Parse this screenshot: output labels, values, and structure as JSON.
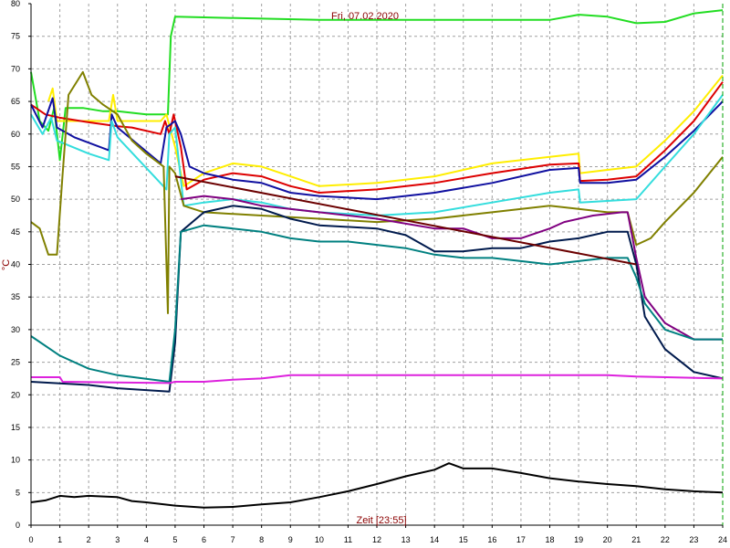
{
  "chart_data": {
    "type": "line",
    "title": "Fri, 07.02.2020",
    "xlabel": "Zeit [23:55]",
    "ylabel": "°C",
    "xlim": [
      0,
      24
    ],
    "ylim": [
      0,
      80
    ],
    "xticks": [
      0,
      1,
      2,
      3,
      4,
      5,
      6,
      7,
      8,
      9,
      10,
      11,
      12,
      13,
      14,
      15,
      16,
      17,
      18,
      19,
      20,
      21,
      22,
      23,
      24
    ],
    "yticks": [
      0,
      5,
      10,
      15,
      20,
      25,
      30,
      35,
      40,
      45,
      50,
      55,
      60,
      65,
      70,
      75,
      80
    ],
    "grid": true,
    "legend": "none",
    "series": [
      {
        "color": "#22dd22",
        "points": [
          [
            0,
            69.5
          ],
          [
            0.3,
            62
          ],
          [
            0.6,
            60.5
          ],
          [
            0.8,
            64
          ],
          [
            1,
            56
          ],
          [
            1.2,
            64
          ],
          [
            1.8,
            64
          ],
          [
            2.5,
            63.5
          ],
          [
            3,
            63.5
          ],
          [
            4,
            63
          ],
          [
            4.75,
            63
          ],
          [
            4.85,
            75
          ],
          [
            5,
            78
          ],
          [
            10,
            77.5
          ],
          [
            14,
            77.5
          ],
          [
            18,
            77.5
          ],
          [
            19,
            78.3
          ],
          [
            20,
            78
          ],
          [
            21,
            77
          ],
          [
            22,
            77.2
          ],
          [
            23,
            78.5
          ],
          [
            24,
            79
          ]
        ]
      },
      {
        "color": "#ffee00",
        "points": [
          [
            0.6,
            65
          ],
          [
            0.75,
            67
          ],
          [
            0.9,
            62
          ],
          [
            2.7,
            62
          ],
          [
            2.85,
            66
          ],
          [
            3,
            62
          ],
          [
            4.5,
            62
          ],
          [
            4.7,
            63
          ],
          [
            5,
            58
          ],
          [
            5.3,
            52
          ],
          [
            6,
            54
          ],
          [
            7,
            55.5
          ],
          [
            8,
            55
          ],
          [
            9,
            53.5
          ],
          [
            10,
            52
          ],
          [
            12,
            52.5
          ],
          [
            14,
            53.5
          ],
          [
            16,
            55.5
          ],
          [
            18,
            56.5
          ],
          [
            19,
            57
          ],
          [
            19.05,
            54
          ],
          [
            20,
            54.5
          ],
          [
            21,
            55
          ],
          [
            22,
            59
          ],
          [
            23,
            63.5
          ],
          [
            24,
            69
          ]
        ]
      },
      {
        "color": "#dd0000",
        "points": [
          [
            0,
            64.5
          ],
          [
            0.5,
            63
          ],
          [
            1,
            62.5
          ],
          [
            2,
            61.8
          ],
          [
            3,
            61.2
          ],
          [
            3.5,
            61
          ],
          [
            4.5,
            60
          ],
          [
            4.65,
            62
          ],
          [
            4.8,
            60
          ],
          [
            4.95,
            63
          ],
          [
            5.2,
            58
          ],
          [
            5.4,
            51.5
          ],
          [
            6,
            53
          ],
          [
            7,
            54
          ],
          [
            8,
            53.5
          ],
          [
            9,
            52
          ],
          [
            10,
            51
          ],
          [
            12,
            51.5
          ],
          [
            14,
            52.5
          ],
          [
            16,
            54
          ],
          [
            18,
            55.3
          ],
          [
            19,
            55.5
          ],
          [
            19.05,
            52.8
          ],
          [
            20,
            53
          ],
          [
            21,
            53.5
          ],
          [
            22,
            57.5
          ],
          [
            23,
            62
          ],
          [
            24,
            68
          ]
        ]
      },
      {
        "color": "#1010a0",
        "points": [
          [
            0,
            64.5
          ],
          [
            0.4,
            61
          ],
          [
            0.75,
            65.5
          ],
          [
            0.9,
            61
          ],
          [
            1.5,
            59.5
          ],
          [
            2.7,
            57.5
          ],
          [
            2.8,
            63
          ],
          [
            3,
            61
          ],
          [
            4.5,
            55.5
          ],
          [
            4.7,
            61
          ],
          [
            5,
            62
          ],
          [
            5.2,
            60
          ],
          [
            5.5,
            55
          ],
          [
            6,
            54
          ],
          [
            7,
            53
          ],
          [
            8,
            52.5
          ],
          [
            9,
            51
          ],
          [
            10,
            50.5
          ],
          [
            12,
            50
          ],
          [
            14,
            51
          ],
          [
            16,
            52.5
          ],
          [
            18,
            54.5
          ],
          [
            19,
            54.8
          ],
          [
            19.05,
            52.5
          ],
          [
            20,
            52.5
          ],
          [
            21,
            53
          ],
          [
            22,
            56.5
          ],
          [
            23,
            60.5
          ],
          [
            24,
            65
          ]
        ]
      },
      {
        "color": "#33dddd",
        "points": [
          [
            0,
            63
          ],
          [
            0.4,
            60
          ],
          [
            0.7,
            62.5
          ],
          [
            0.9,
            59
          ],
          [
            2,
            57
          ],
          [
            2.7,
            56
          ],
          [
            2.8,
            62
          ],
          [
            3,
            59.5
          ],
          [
            4.7,
            51.5
          ],
          [
            4.8,
            60
          ],
          [
            5,
            61
          ],
          [
            5.3,
            49
          ],
          [
            6,
            49.5
          ],
          [
            7,
            50
          ],
          [
            8,
            49.5
          ],
          [
            9,
            48.5
          ],
          [
            10,
            48
          ],
          [
            12,
            47.5
          ],
          [
            14,
            48
          ],
          [
            16,
            49.5
          ],
          [
            18,
            51
          ],
          [
            19,
            51.5
          ],
          [
            19.05,
            49.5
          ],
          [
            21,
            50
          ],
          [
            22,
            55
          ],
          [
            23,
            60
          ],
          [
            24,
            66
          ]
        ]
      },
      {
        "color": "#808000",
        "points": [
          [
            0,
            46.5
          ],
          [
            0.3,
            45.5
          ],
          [
            0.6,
            41.5
          ],
          [
            0.9,
            41.5
          ],
          [
            1.1,
            54
          ],
          [
            1.3,
            66
          ],
          [
            1.8,
            69.5
          ],
          [
            2.1,
            66
          ],
          [
            2.5,
            64.5
          ],
          [
            3,
            63
          ],
          [
            3.5,
            59
          ],
          [
            4,
            57
          ],
          [
            4.6,
            55
          ],
          [
            4.75,
            32.5
          ],
          [
            4.8,
            55
          ],
          [
            5,
            54
          ],
          [
            5.3,
            49
          ],
          [
            6,
            48
          ],
          [
            8,
            47.5
          ],
          [
            10,
            47
          ],
          [
            12,
            46.5
          ],
          [
            14,
            47
          ],
          [
            16,
            48
          ],
          [
            18,
            49
          ],
          [
            19,
            48.5
          ],
          [
            20,
            48
          ],
          [
            20.7,
            48
          ],
          [
            21,
            43
          ],
          [
            21.5,
            44
          ],
          [
            22,
            46.5
          ],
          [
            23,
            51
          ],
          [
            24,
            56.5
          ]
        ]
      },
      {
        "color": "#800080",
        "points": [
          [
            5.2,
            50
          ],
          [
            6,
            50.5
          ],
          [
            7,
            50
          ],
          [
            8,
            49
          ],
          [
            10,
            48
          ],
          [
            12,
            47
          ],
          [
            14,
            45.5
          ],
          [
            15,
            45.5
          ],
          [
            16,
            44
          ],
          [
            17,
            44
          ],
          [
            18,
            45.5
          ],
          [
            18.5,
            46.5
          ],
          [
            19.5,
            47.5
          ],
          [
            20.5,
            48
          ],
          [
            20.7,
            48
          ],
          [
            21,
            41
          ],
          [
            21.3,
            35
          ],
          [
            22,
            31
          ],
          [
            23,
            28.5
          ],
          [
            24,
            28.5
          ]
        ]
      },
      {
        "color": "#001a4d",
        "points": [
          [
            0,
            22
          ],
          [
            2,
            21.5
          ],
          [
            3,
            21
          ],
          [
            4.8,
            20.5
          ],
          [
            5,
            28
          ],
          [
            5.2,
            45
          ],
          [
            6,
            48
          ],
          [
            7,
            49
          ],
          [
            8,
            48.5
          ],
          [
            9,
            47
          ],
          [
            10,
            46
          ],
          [
            12,
            45.5
          ],
          [
            13,
            44.5
          ],
          [
            14,
            42
          ],
          [
            15,
            42
          ],
          [
            16,
            42.5
          ],
          [
            17,
            42.5
          ],
          [
            18,
            43.5
          ],
          [
            19,
            44
          ],
          [
            20,
            45
          ],
          [
            20.7,
            45
          ],
          [
            21,
            40
          ],
          [
            21.3,
            32
          ],
          [
            22,
            27
          ],
          [
            23,
            23.5
          ],
          [
            24,
            22.5
          ]
        ]
      },
      {
        "color": "#008080",
        "points": [
          [
            0,
            29
          ],
          [
            1,
            26
          ],
          [
            2,
            24
          ],
          [
            3,
            23
          ],
          [
            4.8,
            22
          ],
          [
            5,
            30
          ],
          [
            5.2,
            45
          ],
          [
            6,
            46
          ],
          [
            7,
            45.5
          ],
          [
            8,
            45
          ],
          [
            9,
            44
          ],
          [
            10,
            43.5
          ],
          [
            11,
            43.5
          ],
          [
            12,
            43
          ],
          [
            13,
            42.5
          ],
          [
            14,
            41.5
          ],
          [
            15,
            41
          ],
          [
            16,
            41
          ],
          [
            17,
            40.5
          ],
          [
            18,
            40
          ],
          [
            19,
            40.5
          ],
          [
            20,
            41
          ],
          [
            20.7,
            41
          ],
          [
            21,
            38
          ],
          [
            21.3,
            34
          ],
          [
            22,
            30
          ],
          [
            23,
            28.5
          ],
          [
            24,
            28.5
          ]
        ]
      },
      {
        "color": "#6b0000",
        "points": [
          [
            5,
            53.5
          ],
          [
            21,
            40
          ]
        ]
      },
      {
        "color": "#dd22dd",
        "points": [
          [
            0,
            22.7
          ],
          [
            1,
            22.7
          ],
          [
            1.1,
            22
          ],
          [
            4.8,
            21.8
          ],
          [
            5,
            22
          ],
          [
            6,
            22
          ],
          [
            7,
            22.3
          ],
          [
            8,
            22.5
          ],
          [
            9,
            23
          ],
          [
            12,
            23
          ],
          [
            16,
            23
          ],
          [
            20,
            23
          ],
          [
            21,
            22.8
          ],
          [
            24,
            22.5
          ]
        ]
      },
      {
        "color": "#000000",
        "points": [
          [
            0,
            3.5
          ],
          [
            0.5,
            3.8
          ],
          [
            1,
            4.5
          ],
          [
            1.5,
            4.3
          ],
          [
            2,
            4.5
          ],
          [
            3,
            4.3
          ],
          [
            3.5,
            3.7
          ],
          [
            4,
            3.5
          ],
          [
            5,
            3
          ],
          [
            6,
            2.7
          ],
          [
            7,
            2.8
          ],
          [
            8,
            3.2
          ],
          [
            9,
            3.5
          ],
          [
            10,
            4.3
          ],
          [
            11,
            5.2
          ],
          [
            12,
            6.3
          ],
          [
            13,
            7.5
          ],
          [
            14,
            8.5
          ],
          [
            14.5,
            9.5
          ],
          [
            15,
            8.7
          ],
          [
            16,
            8.7
          ],
          [
            17,
            8
          ],
          [
            18,
            7.2
          ],
          [
            19,
            6.7
          ],
          [
            20,
            6.3
          ],
          [
            21,
            6
          ],
          [
            22,
            5.5
          ],
          [
            23,
            5.2
          ],
          [
            24,
            5
          ]
        ]
      }
    ]
  }
}
